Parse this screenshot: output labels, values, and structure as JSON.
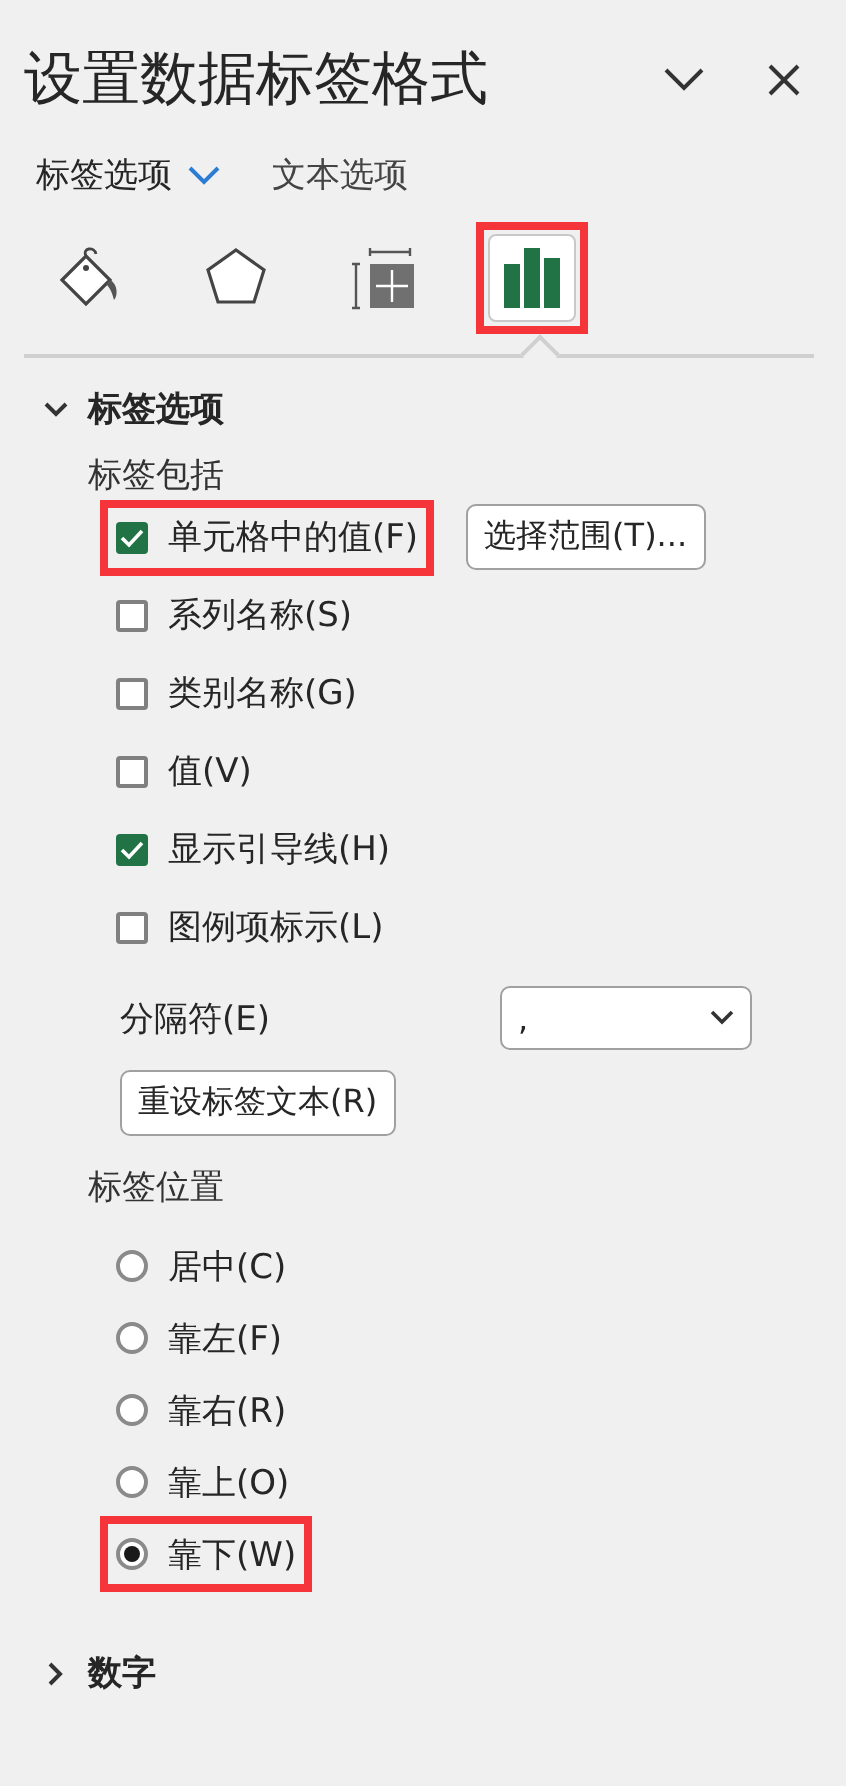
{
  "pane": {
    "title": "设置数据标签格式"
  },
  "option_tabs": [
    {
      "label": "标签选项",
      "selected": true
    },
    {
      "label": "文本选项",
      "selected": false
    }
  ],
  "icon_tabs": [
    {
      "kind": "fill",
      "selected": false,
      "highlighted": false
    },
    {
      "kind": "shape",
      "selected": false,
      "highlighted": false
    },
    {
      "kind": "size",
      "selected": false,
      "highlighted": false
    },
    {
      "kind": "chart",
      "selected": true,
      "highlighted": true
    }
  ],
  "section": {
    "title": "标签选项",
    "expanded": true
  },
  "include_group": {
    "title": "标签包括",
    "items": [
      {
        "label": "单元格中的值(F)",
        "checked": true,
        "highlighted": true
      },
      {
        "label": "系列名称(S)",
        "checked": false,
        "highlighted": false
      },
      {
        "label": "类别名称(G)",
        "checked": false,
        "highlighted": false
      },
      {
        "label": "值(V)",
        "checked": false,
        "highlighted": false
      },
      {
        "label": "显示引导线(H)",
        "checked": true,
        "highlighted": false
      },
      {
        "label": "图例项标示(L)",
        "checked": false,
        "highlighted": false
      }
    ],
    "range_button": "选择范围(T)..."
  },
  "separator": {
    "label": "分隔符(E)",
    "value": ","
  },
  "reset_button": "重设标签文本(R)",
  "position_group": {
    "title": "标签位置",
    "items": [
      {
        "label": "居中(C)",
        "selected": false,
        "highlighted": false
      },
      {
        "label": "靠左(F)",
        "selected": false,
        "highlighted": false
      },
      {
        "label": "靠右(R)",
        "selected": false,
        "highlighted": false
      },
      {
        "label": "靠上(O)",
        "selected": false,
        "highlighted": false
      },
      {
        "label": "靠下(W)",
        "selected": true,
        "highlighted": true
      }
    ]
  },
  "number_section": {
    "title": "数字",
    "expanded": false
  }
}
